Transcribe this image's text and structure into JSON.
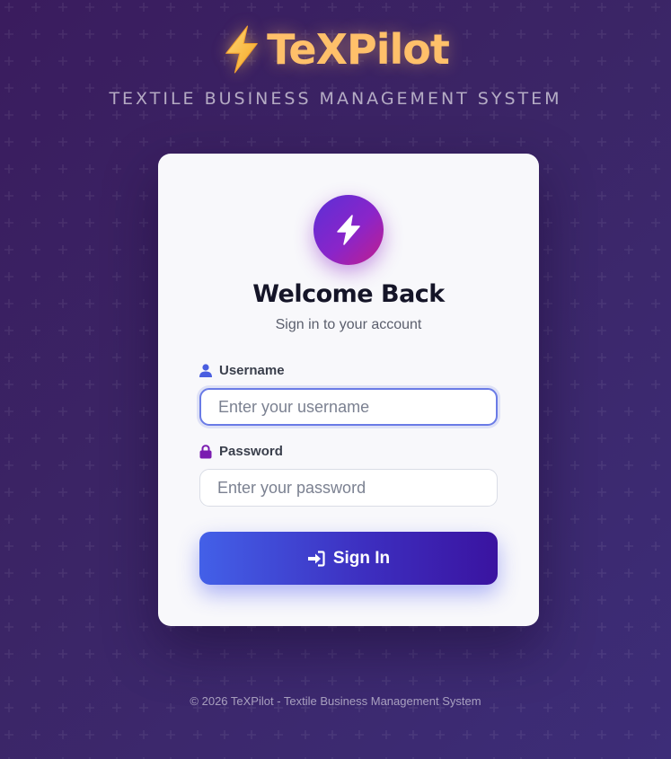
{
  "brand": {
    "icon": "lightning-bolt-icon",
    "title": "TeXPilot",
    "tagline": "TEXTILE BUSINESS MANAGEMENT SYSTEM"
  },
  "card": {
    "logo_icon": "lightning-bolt-icon",
    "title": "Welcome Back",
    "subtitle": "Sign in to your account",
    "username": {
      "icon": "user-icon",
      "label": "Username",
      "placeholder": "Enter your username",
      "value": ""
    },
    "password": {
      "icon": "lock-icon",
      "label": "Password",
      "placeholder": "Enter your password",
      "value": ""
    },
    "submit": {
      "icon": "sign-in-icon",
      "label": "Sign In"
    }
  },
  "footer": {
    "text": "© 2026 TeXPilot - Textile Business Management System"
  },
  "colors": {
    "brand_gold": "#ffc06a",
    "accent_blue": "#4360e8",
    "accent_purple": "#3a13a0",
    "user_icon": "#4a5ee0",
    "lock_icon": "#7a1bb0"
  }
}
